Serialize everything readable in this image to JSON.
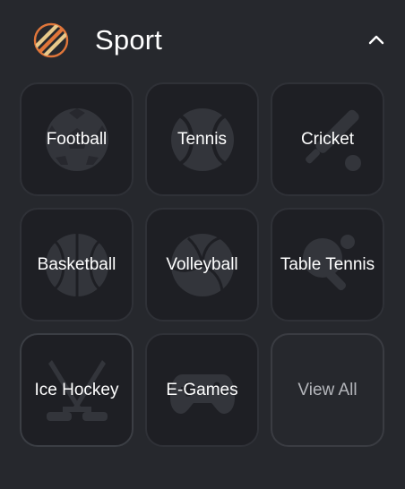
{
  "section": {
    "title": "Sport",
    "logo_icon": "striped-ball-icon",
    "collapse_icon": "chevron-up-icon",
    "accent_color": "#e0763a"
  },
  "tiles": [
    {
      "label": "Football",
      "icon": "soccer-ball-icon"
    },
    {
      "label": "Tennis",
      "icon": "tennis-ball-icon"
    },
    {
      "label": "Cricket",
      "icon": "cricket-bat-icon"
    },
    {
      "label": "Basketball",
      "icon": "basketball-icon"
    },
    {
      "label": "Volleyball",
      "icon": "volleyball-icon"
    },
    {
      "label": "Table Tennis",
      "icon": "ping-pong-icon"
    },
    {
      "label": "Ice Hockey",
      "icon": "hockey-sticks-icon"
    },
    {
      "label": "E-Games",
      "icon": "gamepad-icon"
    },
    {
      "label": "View All"
    }
  ]
}
